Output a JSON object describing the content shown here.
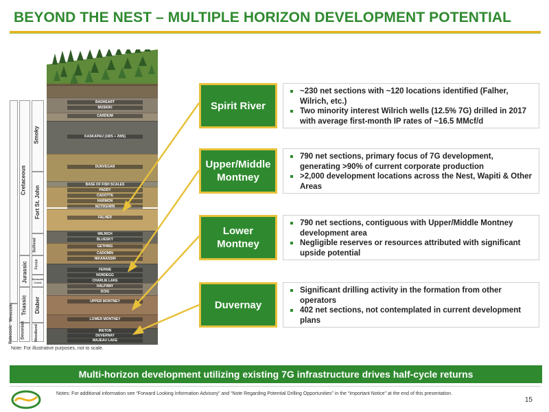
{
  "header": {
    "title": "BEYOND THE NEST – MULTIPLE HORIZON DEVELOPMENT POTENTIAL"
  },
  "column": {
    "formations": [
      "BADHEART",
      "MUSKIKI",
      "CARDIUM",
      "KASKAPAU (1WS + 2WS)",
      "DUNVEGAN",
      "BASE OF FISH SCALES",
      "PADDY",
      "CADOTTE",
      "HARMON",
      "NOTIKEWIN",
      "FALHER",
      "WILRICH",
      "BLUESKY",
      "GETHING",
      "CADOMIN",
      "NIKANASSIN",
      "FERNIE",
      "NORDEGG",
      "CHARLIE LAKE",
      "HALFWAY",
      "DOIG",
      "UPPER MONTNEY",
      "LOWER MONTNEY",
      "IRETON",
      "DUVERNAY",
      "MAJEAU LAKE"
    ],
    "periods": [
      "Paleozoic",
      "Mesozoic"
    ],
    "systems": [
      "Devonian",
      "Triassic",
      "Jurassic",
      "Cretaceous"
    ],
    "groups": [
      "Woodbend",
      "Diaber",
      "Schooler Creek",
      "Fernie",
      "Bullhead",
      "Fort St. John",
      "Smoky"
    ],
    "note": "Note: For illustrative purposes, not to scale."
  },
  "sections": [
    {
      "name": "Spirit River",
      "bullets": [
        "~230 net sections with ~120 locations identified (Falher, Wilrich, etc.)",
        "Two minority interest Wilrich wells (12.5% 7G) drilled in 2017 with average first-month IP rates of  ~16.5 MMcf/d"
      ]
    },
    {
      "name": "Upper/Middle Montney",
      "bullets": [
        "790 net sections, primary focus of 7G development, generating >90% of current corporate production",
        ">2,000 development locations across the Nest, Wapiti & Other Areas"
      ]
    },
    {
      "name": "Lower Montney",
      "bullets": [
        "790 net sections, contiguous with Upper/Middle Montney development area",
        "Negligible reserves or resources attributed with significant upside potential"
      ]
    },
    {
      "name": "Duvernay",
      "bullets": [
        "Significant drilling activity in the formation from other operators",
        "402 net sections, not contemplated in current development plans"
      ]
    }
  ],
  "banner": "Multi-horizon development utilizing existing 7G infrastructure drives half-cycle returns",
  "footer": {
    "notes": "Notes: For additional information see “Forward Looking Information Advisory” and “Note Regarding Potential Drilling Opportunities” in the “Important Notice” at the end of this presentation.",
    "page": "15"
  },
  "colors": {
    "brand_green": "#2f8a2f",
    "accent_gold": "#e8c13a"
  }
}
